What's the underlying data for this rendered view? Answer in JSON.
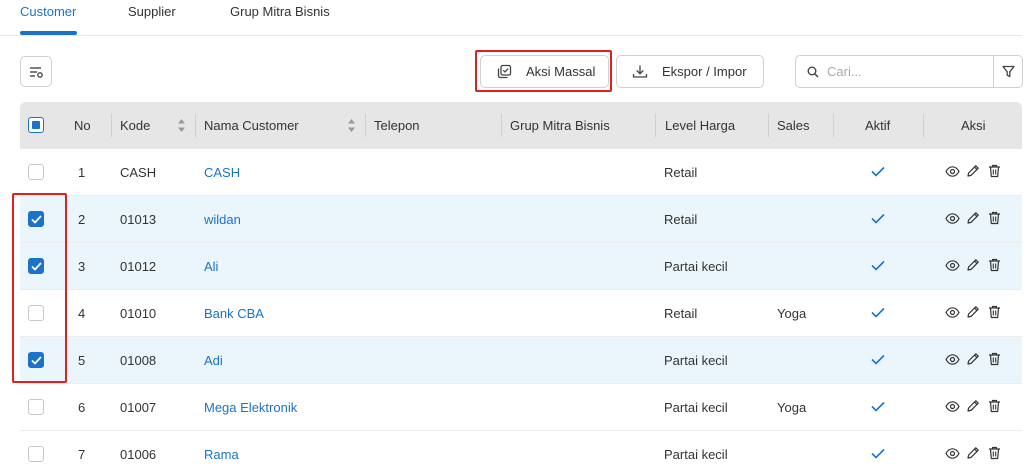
{
  "tabs": [
    {
      "label": "Customer",
      "active": true
    },
    {
      "label": "Supplier",
      "active": false
    },
    {
      "label": "Grup Mitra Bisnis",
      "active": false
    }
  ],
  "toolbar": {
    "mass_action_label": "Aksi Massal",
    "export_import_label": "Ekspor / Impor",
    "search_placeholder": "Cari..."
  },
  "table": {
    "headers": {
      "no": "No",
      "code": "Kode",
      "name": "Nama Customer",
      "phone": "Telepon",
      "group": "Grup Mitra Bisnis",
      "price_level": "Level Harga",
      "sales": "Sales",
      "active": "Aktif",
      "actions": "Aksi"
    },
    "rows": [
      {
        "no": "1",
        "code": "CASH",
        "name": "CASH",
        "phone": "",
        "group": "",
        "price_level": "Retail",
        "sales": "",
        "active": true,
        "checked": false
      },
      {
        "no": "2",
        "code": "01013",
        "name": "wildan",
        "phone": "",
        "group": "",
        "price_level": "Retail",
        "sales": "",
        "active": true,
        "checked": true
      },
      {
        "no": "3",
        "code": "01012",
        "name": "Ali",
        "phone": "",
        "group": "",
        "price_level": "Partai kecil",
        "sales": "",
        "active": true,
        "checked": true
      },
      {
        "no": "4",
        "code": "01010",
        "name": "Bank CBA",
        "phone": "",
        "group": "",
        "price_level": "Retail",
        "sales": "Yoga",
        "active": true,
        "checked": false
      },
      {
        "no": "5",
        "code": "01008",
        "name": "Adi",
        "phone": "",
        "group": "",
        "price_level": "Partai kecil",
        "sales": "",
        "active": true,
        "checked": true
      },
      {
        "no": "6",
        "code": "01007",
        "name": "Mega Elektronik",
        "phone": "",
        "group": "",
        "price_level": "Partai kecil",
        "sales": "Yoga",
        "active": true,
        "checked": false
      },
      {
        "no": "7",
        "code": "01006",
        "name": "Rama",
        "phone": "",
        "group": "",
        "price_level": "Partai kecil",
        "sales": "",
        "active": true,
        "checked": false
      }
    ]
  },
  "icons": {
    "columns_settings": "column-settings-icon",
    "mass_action": "mass-action-icon",
    "export": "download-icon",
    "search": "search-icon",
    "filter": "filter-icon",
    "view": "eye-icon",
    "edit": "pencil-icon",
    "delete": "trash-icon",
    "active": "check-icon"
  },
  "colors": {
    "accent": "#1a73c8",
    "highlight": "#e02020",
    "selected_row": "#eaf6fb",
    "header_bg": "#e6e6e6"
  }
}
